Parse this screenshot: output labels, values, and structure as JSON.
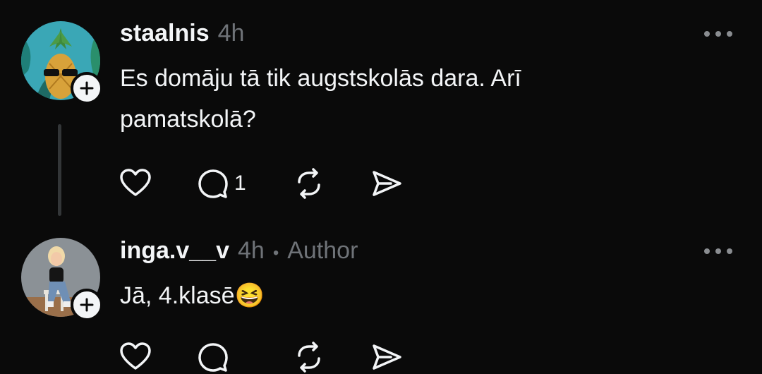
{
  "replies": [
    {
      "username": "staalnis",
      "time": "4h",
      "author_badge": "",
      "text": "Es domāju tā tik augstskolās dara. Arī pamatskolā?",
      "actions": {
        "reply_count": "1"
      }
    },
    {
      "username": "inga.v__v",
      "time": "4h",
      "separator": "•",
      "author_badge": "Author",
      "text": "Jā, 4.klasē😆",
      "actions": {
        "reply_count": ""
      }
    }
  ],
  "icons": {
    "like": "heart-icon",
    "reply": "comment-icon",
    "repost": "repost-icon",
    "share": "send-icon",
    "more": "more-icon",
    "follow": "plus-icon"
  },
  "colors": {
    "background": "#0a0a0a",
    "text": "#f3f5f7",
    "muted": "#6f7378",
    "thread_line": "#333638"
  }
}
